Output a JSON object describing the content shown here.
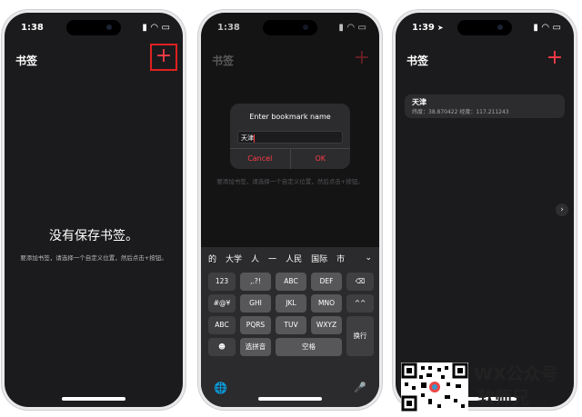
{
  "phone1": {
    "status": {
      "time": "1:38"
    },
    "nav": {
      "title": "书签",
      "add_symbol": "+"
    },
    "empty": {
      "title": "没有保存书签。",
      "subtitle": "要添加书签，请选择一个自定义位置，然后点击+按钮。"
    }
  },
  "phone2": {
    "status": {
      "time": "1:38"
    },
    "nav": {
      "title": "书签",
      "add_symbol": "+"
    },
    "background_hint": "要添加书签，请选择一个自定义位置，然后点击+按钮。",
    "dialog": {
      "title": "Enter bookmark name",
      "input_value": "天津",
      "cancel": "Cancel",
      "ok": "OK"
    },
    "keyboard": {
      "candidates": [
        "的",
        "大学",
        "人",
        "一",
        "人民",
        "国际",
        "市"
      ],
      "expand": "⌄",
      "rows": [
        [
          "123",
          ",.?!",
          "ABC",
          "DEF",
          "⌫"
        ],
        [
          "#@¥",
          "GHI",
          "JKL",
          "MNO",
          "^^"
        ],
        [
          "ABC",
          "PQRS",
          "TUV",
          "WXYZ",
          "换行"
        ],
        [
          "☻",
          "选拼音",
          "空格"
        ]
      ],
      "globe": "🌐",
      "mic": "🎤"
    }
  },
  "phone3": {
    "status": {
      "time": "1:39"
    },
    "nav": {
      "title": "书签",
      "add_symbol": "+"
    },
    "bookmarks": [
      {
        "name": "天津",
        "coords": "纬度：38.870422 经度：117.211243"
      }
    ],
    "side_chevron": "›"
  },
  "watermark": {
    "line1": "WX公众号",
    "line2": "软师兄"
  },
  "colors": {
    "accent": "#ff3b47",
    "screen_bg": "#1b1b1d",
    "highlight_box": "#e02020"
  }
}
